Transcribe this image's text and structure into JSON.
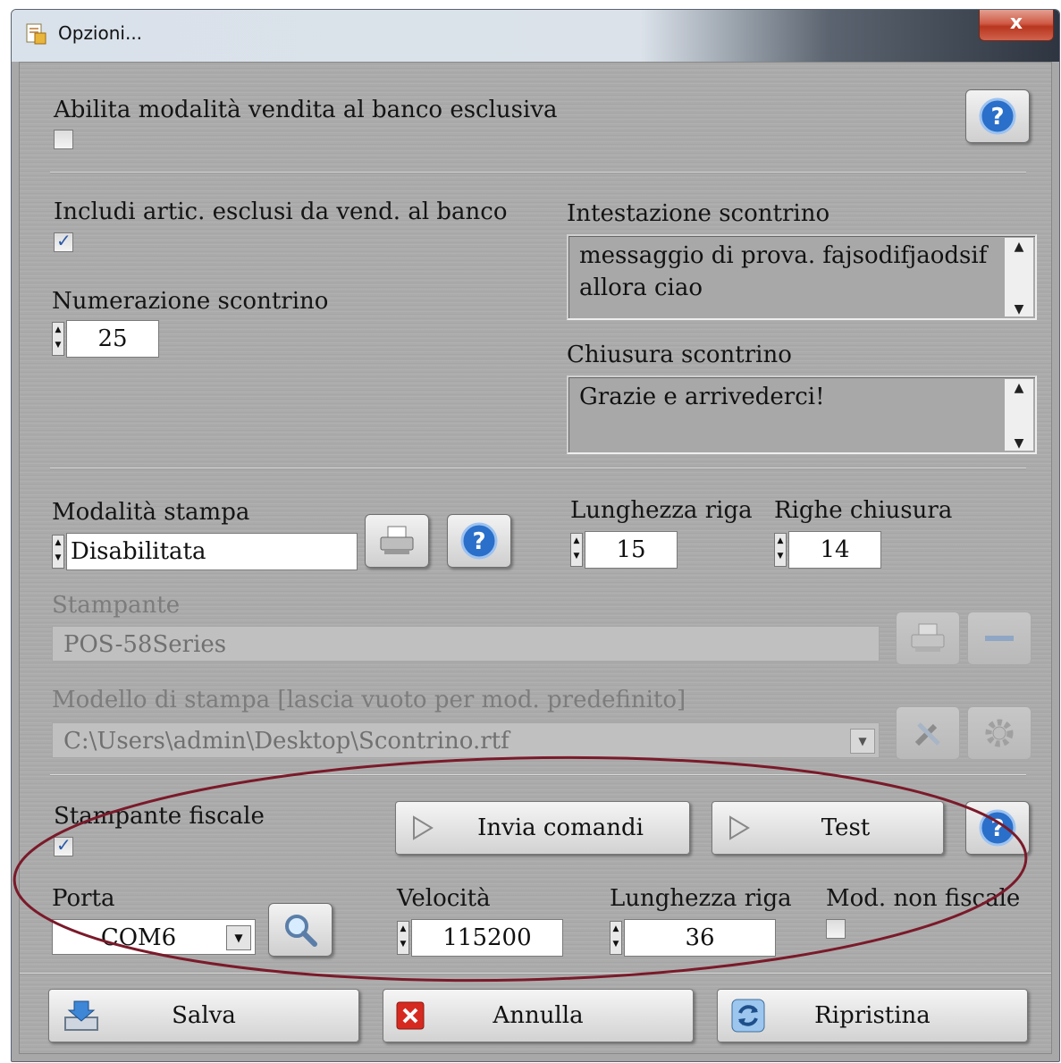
{
  "window": {
    "title": "Opzioni...",
    "close_symbol": "x"
  },
  "section1": {
    "exclusive_label": "Abilita modalità vendita al banco esclusiva",
    "exclusive_checked": false
  },
  "section2": {
    "include_label": "Includi artic. esclusi da vend. al banco",
    "include_checked": true,
    "numbering_label": "Numerazione scontrino",
    "numbering_value": "25",
    "header_label": "Intestazione scontrino",
    "header_text": "messaggio di prova. fajsodifjaodsif allora ciao",
    "closing_label": "Chiusura scontrino",
    "closing_text": "Grazie e arrivederci!"
  },
  "section3": {
    "print_mode_label": "Modalità stampa",
    "print_mode_value": "Disabilitata",
    "line_length_label": "Lunghezza riga",
    "line_length_value": "15",
    "closing_rows_label": "Righe chiusura",
    "closing_rows_value": "14",
    "printer_label": "Stampante",
    "printer_value": "POS-58Series",
    "template_label": "Modello di stampa [lascia vuoto per mod. predefinito]",
    "template_value": "C:\\Users\\admin\\Desktop\\Scontrino.rtf"
  },
  "section4": {
    "fiscal_label": "Stampante fiscale",
    "fiscal_checked": true,
    "send_commands_label": "Invia comandi",
    "test_label": "Test",
    "port_label": "Porta",
    "port_value": "COM6",
    "speed_label": "Velocità",
    "speed_value": "115200",
    "line_length_label": "Lunghezza riga",
    "line_length_value": "36",
    "nonfiscal_label": "Mod. non fiscale",
    "nonfiscal_checked": false
  },
  "footer": {
    "save_label": "Salva",
    "cancel_label": "Annulla",
    "reset_label": "Ripristina"
  },
  "colors": {
    "annotation_ellipse": "#7a1a2a",
    "help_icon": "#2a6fc9",
    "cancel_icon": "#d62a20"
  }
}
